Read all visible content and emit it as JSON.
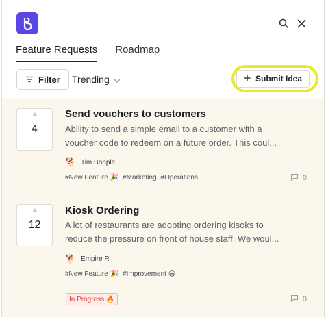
{
  "header": {
    "logo_icon": "chat-bubble-logo-icon",
    "brand_color": "#5b46e6",
    "search_icon": "search-icon",
    "close_icon": "close-icon"
  },
  "tabs": [
    {
      "label": "Feature Requests",
      "active": true
    },
    {
      "label": "Roadmap",
      "active": false
    }
  ],
  "toolbar": {
    "filter_label": "Filter",
    "sort_label": "Trending",
    "submit_label": "Submit Idea",
    "highlight_color": "#eaea23"
  },
  "posts": [
    {
      "votes": "4",
      "title": "Send vouchers to customers",
      "desc_line1": "Ability to send a simple email to a customer with a",
      "desc_line2": "voucher code to redeem on a future order. This coul...",
      "author": "Tim Bopple",
      "tags": [
        "#New Feature 🎉",
        "#Marketing",
        "#Operations"
      ],
      "comments": "0"
    },
    {
      "votes": "12",
      "title": "Kiosk Ordering",
      "desc_line1": "A lot of restaurants are adopting ordering kisoks to",
      "desc_line2": "reduce the pressure on front of house staff. We woul...",
      "author": "Empire R",
      "tags": [
        "#New Feature 🎉",
        "#Improvement 😀"
      ],
      "status": "In Progress 🔥",
      "comments": "0"
    }
  ]
}
